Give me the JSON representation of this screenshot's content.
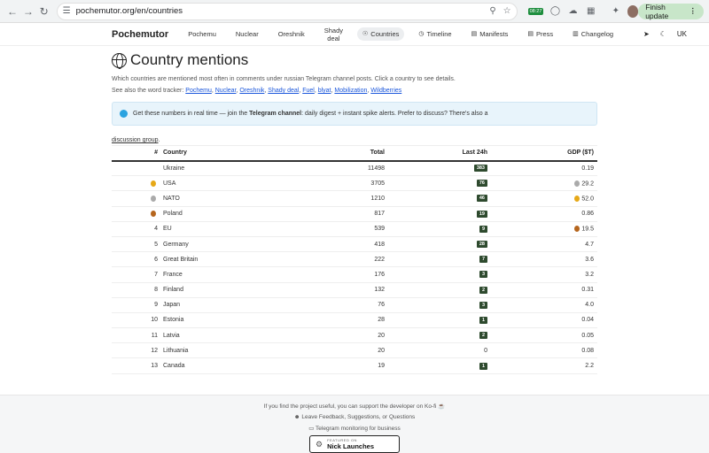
{
  "browser": {
    "url": "pochemutor.org/en/countries",
    "ext_badge": "08:27",
    "finish_label": "Finish update"
  },
  "nav": {
    "brand": "Pochemutor",
    "links": [
      "Pochemu",
      "Nuclear",
      "Oreshnik",
      "Shady deal"
    ],
    "countries": "Countries",
    "timeline": "Timeline",
    "manifests": "Manifests",
    "press": "Press",
    "changelog": "Changelog",
    "lang": "UK"
  },
  "page": {
    "title": "Country mentions",
    "subtitle": "Which countries are mentioned most often in comments under russian Telegram channel posts. Click a country to see details.",
    "see_also": "See also the word tracker:",
    "see_links": [
      "Pochemu",
      "Nuclear",
      "Oreshnik",
      "Shady deal",
      "Fuel",
      "blyat",
      "Mobilization",
      "Wildberries"
    ],
    "notice_pre": "Get these numbers in real time — join the",
    "notice_bold": "Telegram channel",
    "notice_post": ": daily digest + instant spike alerts. Prefer to discuss? There's also a",
    "discussion": "discussion group",
    "discussion_tail": "."
  },
  "table": {
    "headers": {
      "num": "#",
      "country": "Country",
      "total": "Total",
      "last24": "Last 24h",
      "gdp": "GDP ($T)"
    },
    "rows": [
      {
        "num": "",
        "medal": "",
        "country": "Ukraine",
        "total": "11498",
        "last24": "383",
        "gdp_medal": "",
        "gdp": "0.19"
      },
      {
        "num": "",
        "medal": "gold",
        "country": "USA",
        "total": "3705",
        "last24": "76",
        "gdp_medal": "silver",
        "gdp": "29.2"
      },
      {
        "num": "",
        "medal": "silver",
        "country": "NATO",
        "total": "1210",
        "last24": "46",
        "gdp_medal": "gold",
        "gdp": "52.0"
      },
      {
        "num": "",
        "medal": "bronze",
        "country": "Poland",
        "total": "817",
        "last24": "19",
        "gdp_medal": "",
        "gdp": "0.86"
      },
      {
        "num": "4",
        "medal": "",
        "country": "EU",
        "total": "539",
        "last24": "9",
        "gdp_medal": "bronze",
        "gdp": "19.5"
      },
      {
        "num": "5",
        "medal": "",
        "country": "Germany",
        "total": "418",
        "last24": "28",
        "gdp_medal": "",
        "gdp": "4.7"
      },
      {
        "num": "6",
        "medal": "",
        "country": "Great Britain",
        "total": "222",
        "last24": "7",
        "gdp_medal": "",
        "gdp": "3.6"
      },
      {
        "num": "7",
        "medal": "",
        "country": "France",
        "total": "176",
        "last24": "3",
        "gdp_medal": "",
        "gdp": "3.2"
      },
      {
        "num": "8",
        "medal": "",
        "country": "Finland",
        "total": "132",
        "last24": "2",
        "gdp_medal": "",
        "gdp": "0.31"
      },
      {
        "num": "9",
        "medal": "",
        "country": "Japan",
        "total": "76",
        "last24": "3",
        "gdp_medal": "",
        "gdp": "4.0"
      },
      {
        "num": "10",
        "medal": "",
        "country": "Estonia",
        "total": "28",
        "last24": "1",
        "gdp_medal": "",
        "gdp": "0.04"
      },
      {
        "num": "11",
        "medal": "",
        "country": "Latvia",
        "total": "20",
        "last24": "2",
        "gdp_medal": "",
        "gdp": "0.05"
      },
      {
        "num": "12",
        "medal": "",
        "country": "Lithuania",
        "total": "20",
        "last24": "0",
        "gdp_medal": "",
        "gdp": "0.08"
      },
      {
        "num": "13",
        "medal": "",
        "country": "Canada",
        "total": "19",
        "last24": "1",
        "gdp_medal": "",
        "gdp": "2.2"
      }
    ]
  },
  "footer": {
    "support": "If you find the project useful, you can support the developer on Ko-fi ☕",
    "feedback": "Leave Feedback, Suggestions, or Questions",
    "business": "Telegram monitoring for business",
    "badge_small": "FEATURED ON",
    "badge_big": "Nick Launches"
  }
}
